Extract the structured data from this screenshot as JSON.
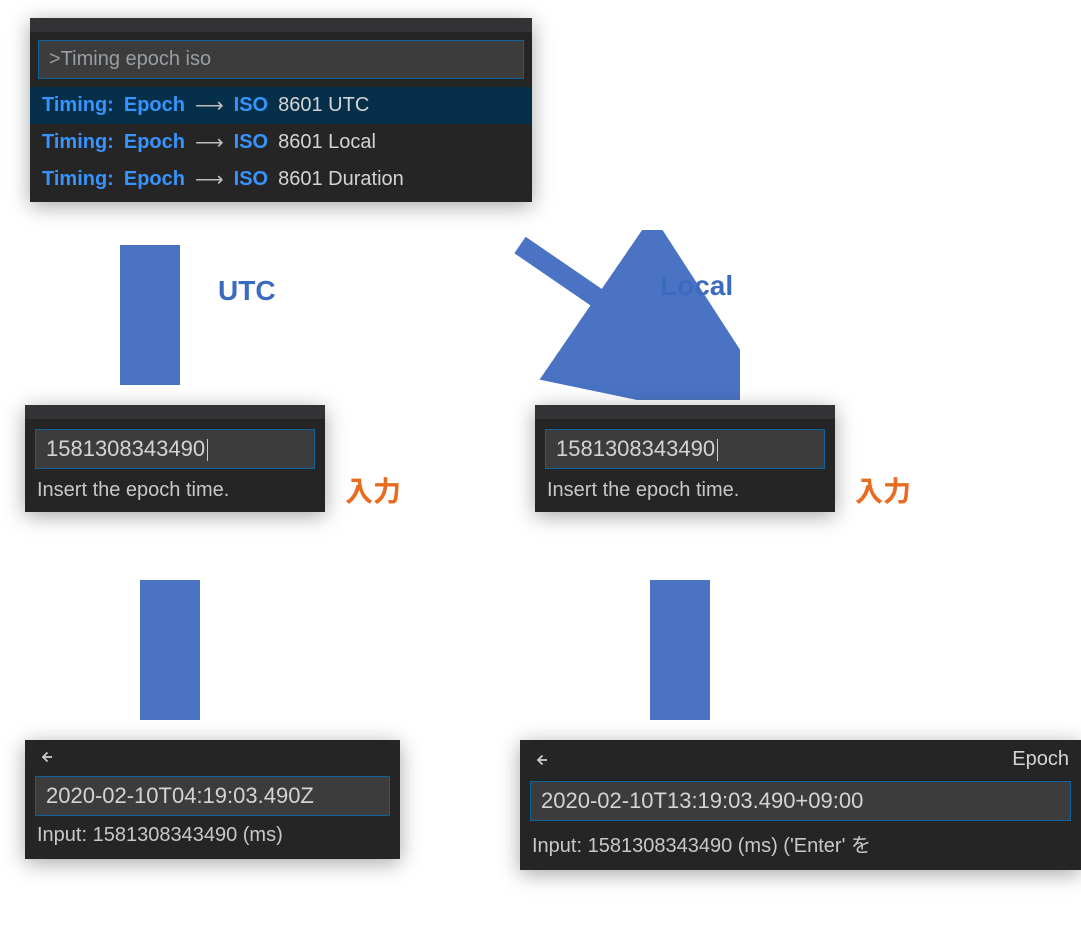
{
  "colors": {
    "accent": "#3b6bbf",
    "orange": "#e86b1f",
    "match": "#3794ff",
    "panel": "#252526",
    "input_border": "#0e639c",
    "input_bg": "#3c3c3c"
  },
  "palette": {
    "query": ">Timing epoch iso",
    "options": [
      {
        "segments": [
          "Timing:",
          " ",
          "Epoch",
          " ⟶ ",
          "ISO",
          " 8601 UTC"
        ],
        "match_flags": [
          true,
          false,
          true,
          false,
          true,
          false
        ],
        "selected": true
      },
      {
        "segments": [
          "Timing:",
          " ",
          "Epoch",
          " ⟶ ",
          "ISO",
          " 8601 Local"
        ],
        "match_flags": [
          true,
          false,
          true,
          false,
          true,
          false
        ],
        "selected": false
      },
      {
        "segments": [
          "Timing:",
          " ",
          "Epoch",
          " ⟶ ",
          "ISO",
          " 8601 Duration"
        ],
        "match_flags": [
          true,
          false,
          true,
          false,
          true,
          false
        ],
        "selected": false
      }
    ]
  },
  "arrows": {
    "utc_label": "UTC",
    "local_label": "Local"
  },
  "labels": {
    "input": "入力"
  },
  "utc": {
    "input_value": "1581308343490",
    "input_hint": "Insert the epoch time.",
    "result": "2020-02-10T04:19:03.490Z",
    "meta": "Input: 1581308343490 (ms)"
  },
  "local": {
    "input_value": "1581308343490",
    "input_hint": "Insert the epoch time.",
    "back_title": "Epoch",
    "result": "2020-02-10T13:19:03.490+09:00",
    "meta": "Input: 1581308343490 (ms) ('Enter' を"
  }
}
